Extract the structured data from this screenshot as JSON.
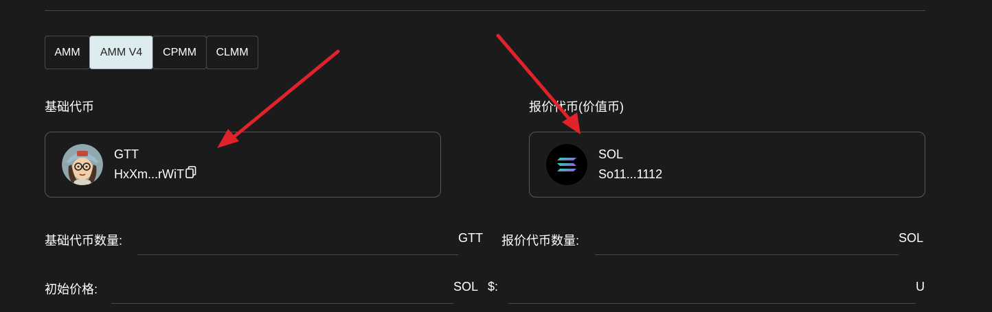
{
  "tabs": [
    {
      "label": "AMM",
      "active": false
    },
    {
      "label": "AMM V4",
      "active": true
    },
    {
      "label": "CPMM",
      "active": false
    },
    {
      "label": "CLMM",
      "active": false
    }
  ],
  "base_token": {
    "section_label": "基础代币",
    "symbol": "GTT",
    "address": "HxXm...rWiT",
    "avatar_icon": "cartoon-avatar-icon"
  },
  "quote_token": {
    "section_label": "报价代币(价值币)",
    "symbol": "SOL",
    "address": "So11...1112",
    "avatar_icon": "solana-logo-icon"
  },
  "fields": {
    "base_amount": {
      "label": "基础代币数量:",
      "unit": "GTT",
      "value": ""
    },
    "quote_amount": {
      "label": "报价代币数量:",
      "unit": "SOL",
      "value": ""
    },
    "initial_price": {
      "label": "初始价格:",
      "unit": "SOL",
      "value": ""
    },
    "usd_price": {
      "label": "$:",
      "unit": "U",
      "value": ""
    }
  },
  "colors": {
    "background": "#1b1b1b",
    "active_tab": "#ddedef",
    "annotation_arrow": "#e0222a"
  }
}
